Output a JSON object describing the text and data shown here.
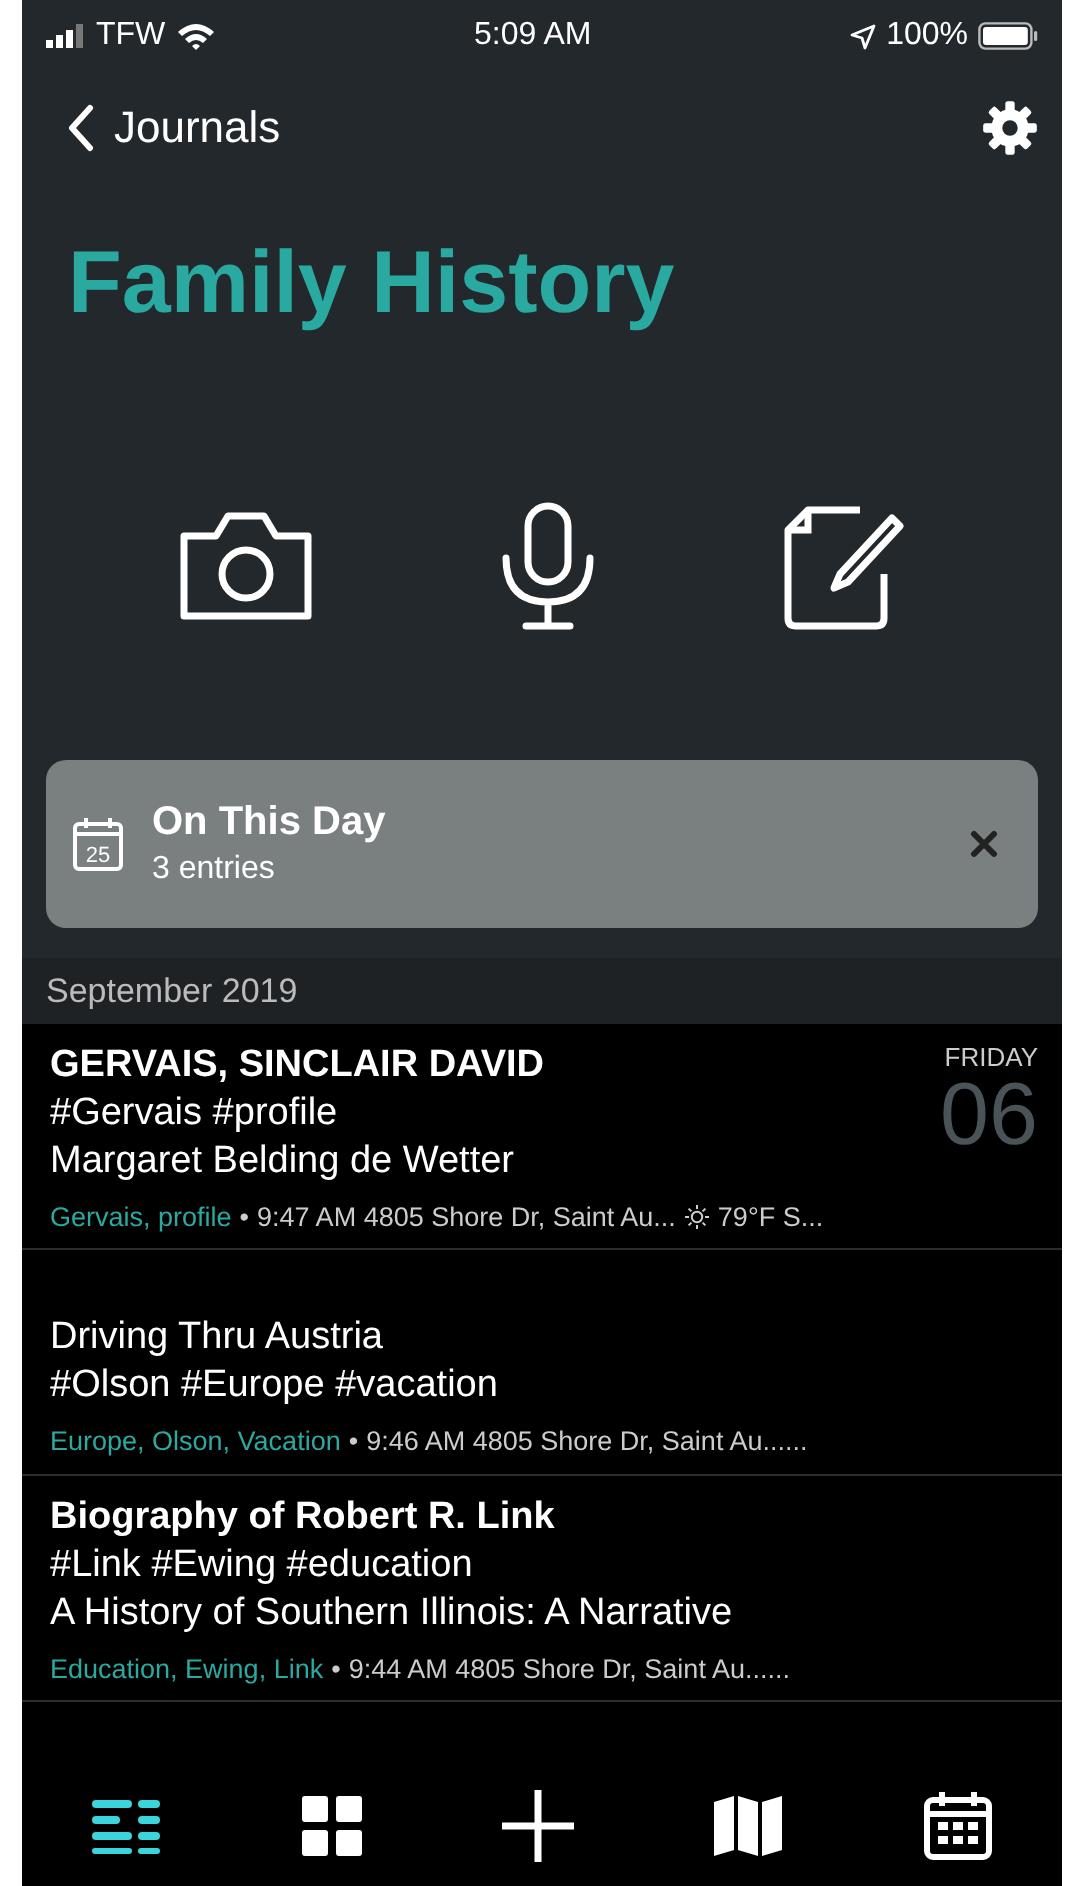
{
  "status_bar": {
    "carrier": "TFW",
    "time": "5:09 AM",
    "battery": "100%"
  },
  "nav": {
    "back_label": "Journals"
  },
  "title": "Family History",
  "on_this_day": {
    "title": "On This Day",
    "subtitle": "3 entries",
    "calendar_day": "25"
  },
  "section": "September 2019",
  "entries": [
    {
      "kind": "titled",
      "title": "GERVAIS, SINCLAIR DAVID",
      "lines": [
        "#Gervais #profile",
        "Margaret Belding de Wetter"
      ],
      "tags": "Gervais, profile",
      "separator": "•",
      "meta": "9:47 AM 4805 Shore Dr, Saint Au...",
      "weather": "79°F S...",
      "weekday": "FRIDAY",
      "day": "06"
    },
    {
      "kind": "untitled",
      "title": "Driving Thru Austria",
      "lines": [
        "#Olson #Europe #vacation"
      ],
      "tags": "Europe, Olson, Vacation",
      "separator": "•",
      "meta": "9:46 AM 4805 Shore Dr, Saint Au......"
    },
    {
      "kind": "titled",
      "title": "Biography of Robert R. Link",
      "lines": [
        "#Link #Ewing #education",
        "A History of Southern Illinois: A Narrative"
      ],
      "tags": "Education, Ewing, Link",
      "separator": "•",
      "meta": "9:44 AM 4805 Shore Dr, Saint Au......"
    }
  ],
  "tabs": [
    {
      "kind": "list",
      "selected": true
    },
    {
      "kind": "grid",
      "selected": false
    },
    {
      "kind": "add",
      "selected": false
    },
    {
      "kind": "map",
      "selected": false
    },
    {
      "kind": "calendar",
      "selected": false
    }
  ]
}
